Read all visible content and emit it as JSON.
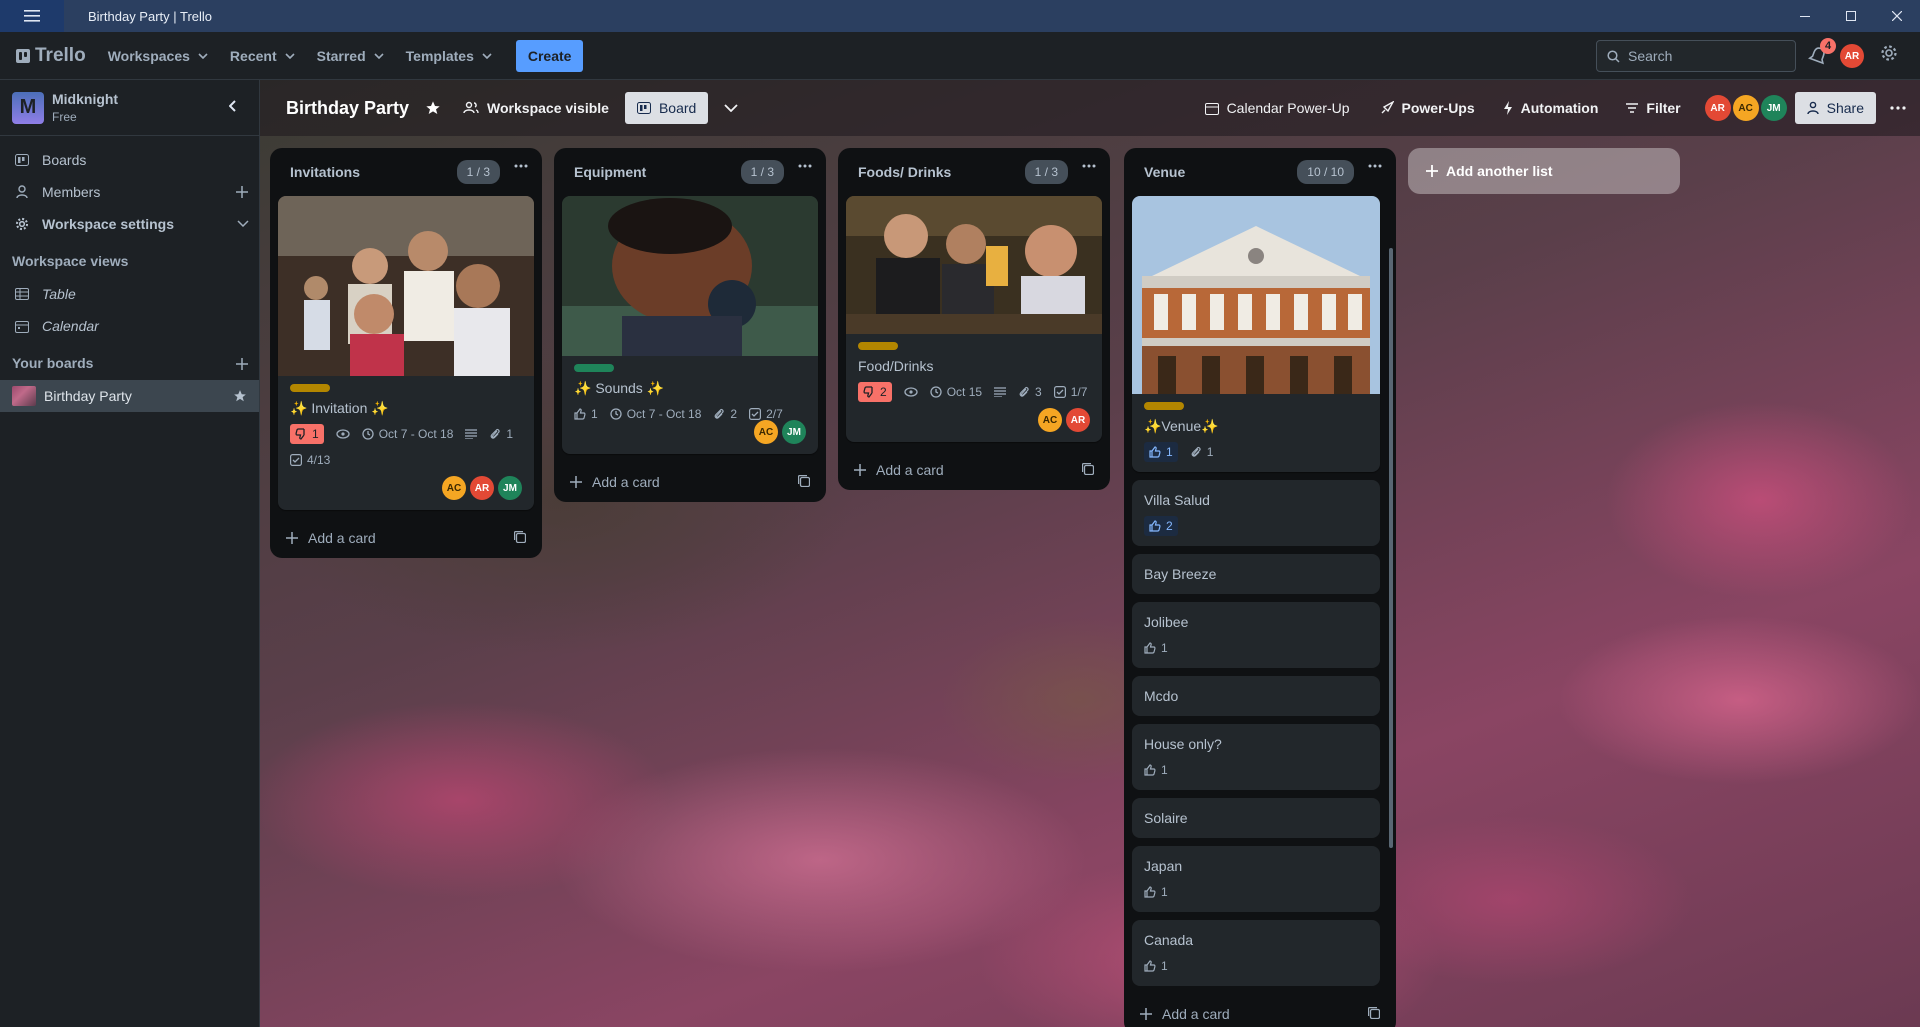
{
  "window": {
    "title": "Birthday Party | Trello"
  },
  "nav": {
    "logo": "Trello",
    "workspaces": "Workspaces",
    "recent": "Recent",
    "starred": "Starred",
    "templates": "Templates",
    "create": "Create",
    "search_placeholder": "Search",
    "notifications_count": "4",
    "user_initials": "AR"
  },
  "sidebar": {
    "workspace_initial": "M",
    "workspace_name": "Midknight",
    "plan": "Free",
    "items": [
      {
        "label": "Boards"
      },
      {
        "label": "Members"
      },
      {
        "label": "Workspace settings"
      }
    ],
    "views_heading": "Workspace views",
    "views": [
      {
        "label": "Table"
      },
      {
        "label": "Calendar"
      }
    ],
    "your_boards_heading": "Your boards",
    "boards": [
      {
        "label": "Birthday Party"
      }
    ]
  },
  "board": {
    "title": "Birthday Party",
    "visibility": "Workspace visible",
    "view": "Board",
    "calendar_powerup": "Calendar Power-Up",
    "powerups": "Power-Ups",
    "automation": "Automation",
    "filter": "Filter",
    "members": [
      "AR",
      "AC",
      "JM"
    ],
    "share": "Share",
    "add_list": "Add another list",
    "add_card": "Add a card"
  },
  "lists": [
    {
      "title": "Invitations",
      "count": "1 / 3",
      "card": {
        "title": "✨ Invitation ✨",
        "label_color": "#b38600",
        "votes": "1",
        "dates": "Oct 7 - Oct 18",
        "attachments": "1",
        "checklist": "4/13",
        "members": [
          "AC",
          "AR",
          "JM"
        ]
      }
    },
    {
      "title": "Equipment",
      "count": "1 / 3",
      "card": {
        "title": "✨ Sounds ✨",
        "label_color": "#1f845a",
        "likes": "1",
        "dates": "Oct 7 - Oct 18",
        "attachments": "2",
        "checklist": "2/7",
        "members": [
          "AC",
          "JM"
        ]
      }
    },
    {
      "title": "Foods/ Drinks",
      "count": "1 / 3",
      "card": {
        "title": "Food/Drinks",
        "label_color": "#b38600",
        "votes": "2",
        "date": "Oct 15",
        "attachments": "3",
        "checklist": "1/7",
        "members": [
          "AC",
          "AR"
        ]
      }
    },
    {
      "title": "Venue",
      "count": "10 / 10",
      "card": {
        "title": "✨Venue✨",
        "label_color": "#b38600",
        "likes": "1",
        "attachments": "1"
      },
      "cards": [
        {
          "title": "Villa Salud",
          "likes": "2"
        },
        {
          "title": "Bay Breeze"
        },
        {
          "title": "Jolibee",
          "likes": "1"
        },
        {
          "title": "Mcdo"
        },
        {
          "title": "House only?",
          "likes": "1"
        },
        {
          "title": "Solaire"
        },
        {
          "title": "Japan",
          "likes": "1"
        },
        {
          "title": "Canada",
          "likes": "1"
        }
      ]
    }
  ]
}
